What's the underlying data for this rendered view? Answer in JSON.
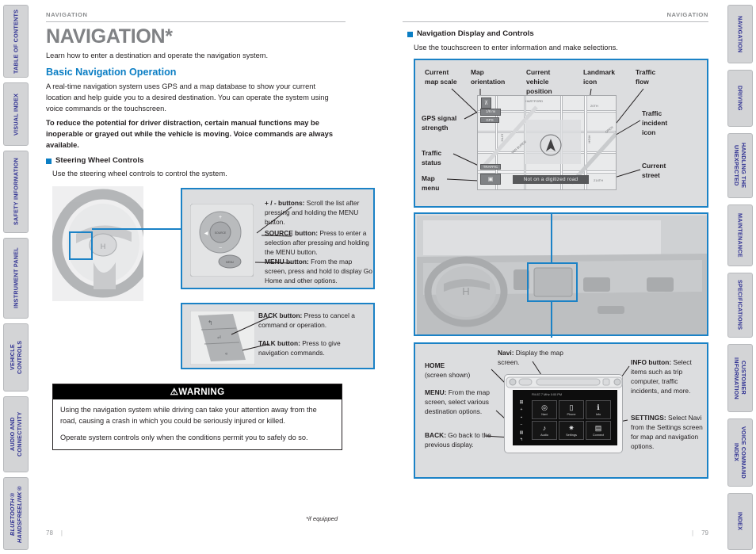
{
  "left_tabs": [
    {
      "label": "TABLE OF CONTENTS",
      "italic": false
    },
    {
      "label": "VISUAL INDEX",
      "italic": false
    },
    {
      "label": "SAFETY INFORMATION",
      "italic": false
    },
    {
      "label": "INSTRUMENT PANEL",
      "italic": false
    },
    {
      "label": "VEHICLE\nCONTROLS",
      "italic": false
    },
    {
      "label": "AUDIO AND\nCONNECTIVITY",
      "italic": false
    },
    {
      "label": "BLUETOOTH®\nHANDSFREELINK®",
      "italic": true
    }
  ],
  "right_tabs": [
    {
      "label": "NAVIGATION"
    },
    {
      "label": "DRIVING"
    },
    {
      "label": "HANDLING THE\nUNEXPECTED"
    },
    {
      "label": "MAINTENANCE"
    },
    {
      "label": "SPECIFICATIONS"
    },
    {
      "label": "CUSTOMER\nINFORMATION"
    },
    {
      "label": "VOICE COMMAND\nINDEX"
    },
    {
      "label": "INDEX"
    }
  ],
  "left_page": {
    "running_head": "NAVIGATION",
    "title": "NAVIGATION*",
    "intro": "Learn how to enter a destination and operate the navigation system.",
    "section_heading": "Basic Navigation Operation",
    "body_1": "A real-time navigation system uses GPS and a map database to show your current location and help guide you to a desired destination. You can operate the system using voice commands or the touchscreen.",
    "body_2": "To reduce the potential for driver distraction, certain manual functions may be inoperable or grayed out while the vehicle is moving. Voice commands are always available.",
    "subhead": "Steering Wheel Controls",
    "subhead_caption": "Use the steering wheel controls to control the system.",
    "callouts_top": [
      {
        "term": "+ / - buttons:",
        "text": " Scroll the list after pressing and holding the MENU button."
      },
      {
        "term": "SOURCE button:",
        "text": " Press to enter a selection after pressing and holding the MENU button."
      },
      {
        "term": "MENU button:",
        "text": " From the map screen, press and hold to display Go Home and other options."
      }
    ],
    "callouts_bottom": [
      {
        "term": "BACK button:",
        "text": " Press to cancel a command or operation."
      },
      {
        "term": "TALK button:",
        "text": " Press to give navigation commands."
      }
    ],
    "wheel_buttons": {
      "plus": "+",
      "minus": "−",
      "source": "SOURCE",
      "menu": "MENU"
    },
    "warning": {
      "heading": "WARNING",
      "symbol": "⚠",
      "lines": [
        "Using the navigation system while driving can take your attention away from the road, causing a crash in which you could be seriously injured or killed.",
        "Operate system controls only when the conditions permit you to safely do so."
      ]
    },
    "footnote": "*if equipped",
    "folio": "78"
  },
  "right_page": {
    "running_head": "NAVIGATION",
    "subhead": "Navigation Display and Controls",
    "subhead_caption": "Use the touchscreen to enter information and make selections.",
    "map_labels": {
      "map_scale": "Current\nmap scale",
      "map_orientation": "Map\norientation",
      "vehicle_position": "Current\nvehicle\nposition",
      "landmark": "Landmark\nicon",
      "traffic_flow": "Traffic\nflow",
      "gps_signal": "GPS signal\nstrength",
      "traffic_status": "Traffic\nstatus",
      "map_menu": "Map\nmenu",
      "traffic_incident": "Traffic\nincident\nicon",
      "current_street": "Current\nstreet"
    },
    "map_screen": {
      "scale_chip": "1/8 mi",
      "gps_chip": "GPS",
      "traffic_chip": "TRAFFIC",
      "banner": "Not on a digitized road",
      "streets": [
        "HARTFORD",
        "20TH",
        "10TH",
        "VAN BUREN",
        "HIGH",
        "OPEN",
        "214TH"
      ]
    },
    "unit_callouts": [
      {
        "term": "HOME",
        "text": "(screen shown)"
      },
      {
        "term": "MENU:",
        "text": " From the map screen, select various destination options."
      },
      {
        "term": "BACK:",
        "text": " Go back to the previous display."
      },
      {
        "term": "Navi:",
        "text": " Display the map screen."
      },
      {
        "term": "INFO button:",
        "text": " Select items such as trip computer, traffic incidents, and more."
      },
      {
        "term": "SETTINGS:",
        "text": " Select Navi from the Settings screen for map and navigation options."
      }
    ],
    "unit_screen": {
      "status_bar": "FM  87.7 MHz      0:00 PM",
      "tiles": [
        {
          "label": "Navi",
          "icon": "navi-icon",
          "glyph": "◎"
        },
        {
          "label": "Phone",
          "icon": "phone-icon",
          "glyph": "▯"
        },
        {
          "label": "Info",
          "icon": "info-icon",
          "glyph": "ℹ"
        },
        {
          "label": "Audio",
          "icon": "audio-icon",
          "glyph": "♪"
        },
        {
          "label": "Settings",
          "icon": "gear-icon",
          "glyph": "✷"
        },
        {
          "label": "Connect",
          "icon": "connect-icon",
          "glyph": "▤"
        }
      ],
      "side_keys": [
        "⊞",
        "+",
        "▪",
        "−",
        "▤",
        "↰"
      ]
    },
    "folio": "79"
  },
  "colors": {
    "accent_blue": "#1b82c6",
    "heading_blue": "#0b7ec4",
    "tab_text": "#2f3192",
    "title_gray": "#808285",
    "panel_gray": "#dcdddf"
  }
}
